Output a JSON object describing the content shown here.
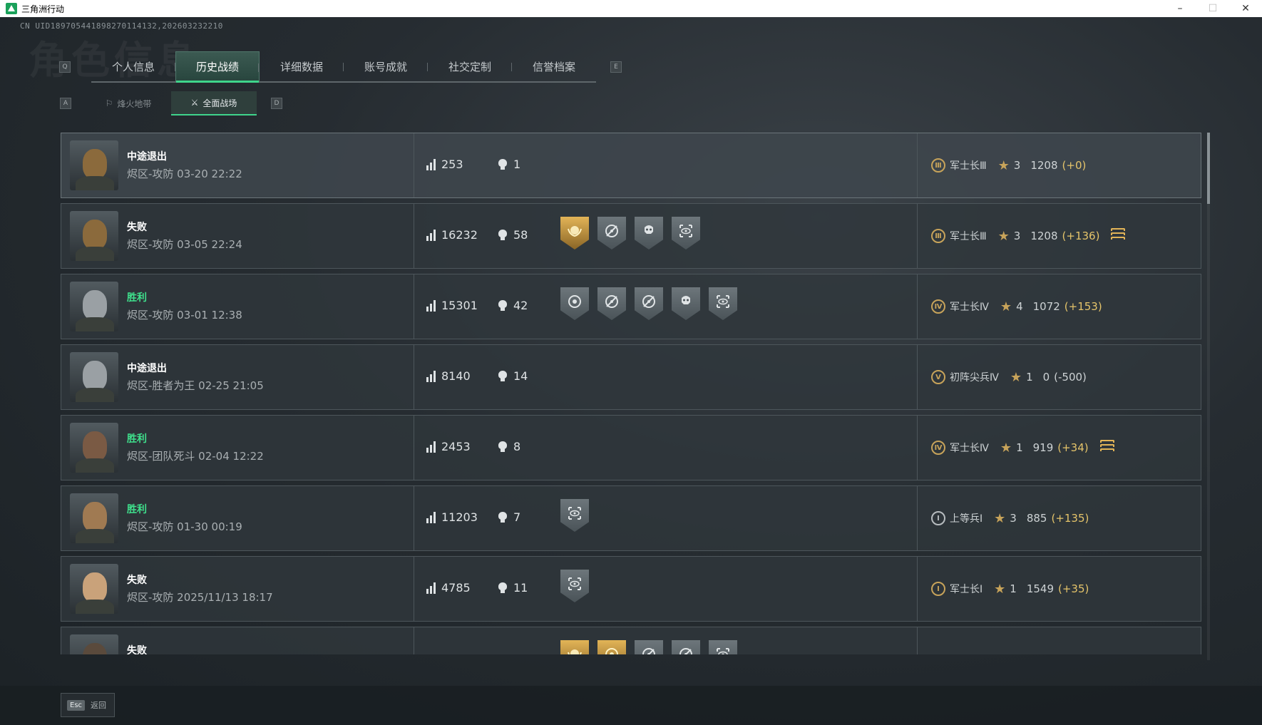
{
  "window": {
    "title": "三角洲行动",
    "minimize": "–",
    "maximize": "☐",
    "close": "✕"
  },
  "uid": "CN UID189705441898270114132,202603232210",
  "watermark": "角色信息",
  "hints": {
    "main_left": "Q",
    "main_right": "E",
    "sub_left": "A",
    "sub_right": "D"
  },
  "main_tabs": [
    {
      "label": "个人信息",
      "active": false
    },
    {
      "label": "历史战绩",
      "active": true
    },
    {
      "label": "详细数据",
      "active": false
    },
    {
      "label": "账号成就",
      "active": false
    },
    {
      "label": "社交定制",
      "active": false
    },
    {
      "label": "信誉档案",
      "active": false
    }
  ],
  "sub_tabs": [
    {
      "label": "烽火地带",
      "active": false
    },
    {
      "label": "全面战场",
      "active": true
    }
  ],
  "matches": [
    {
      "result": "中途退出",
      "result_type": "other",
      "mode": "烬区-攻防 03-20 22:22",
      "score": "253",
      "kills": "1",
      "badges": [],
      "rank_icon": "Ⅲ",
      "rank_name": "军士长Ⅲ",
      "stars": "3",
      "points": "1208",
      "delta": "(+0)",
      "delta_type": "pos",
      "chevron": false,
      "avatar_color": "#8b6a3c"
    },
    {
      "result": "失败",
      "result_type": "loss",
      "mode": "烬区-攻防 03-05 22:24",
      "score": "16232",
      "kills": "58",
      "badges": [
        "gold-laurel",
        "crosshair",
        "skull",
        "eye-target"
      ],
      "rank_icon": "Ⅲ",
      "rank_name": "军士长Ⅲ",
      "stars": "3",
      "points": "1208",
      "delta": "(+136)",
      "delta_type": "pos",
      "chevron": true,
      "avatar_color": "#8b6a3c"
    },
    {
      "result": "胜利",
      "result_type": "win",
      "mode": "烬区-攻防 03-01 12:38",
      "score": "15301",
      "kills": "42",
      "badges": [
        "target",
        "crosshair",
        "crosshair",
        "skull",
        "eye-target"
      ],
      "rank_icon": "Ⅳ",
      "rank_name": "军士长Ⅳ",
      "stars": "4",
      "points": "1072",
      "delta": "(+153)",
      "delta_type": "pos",
      "chevron": false,
      "avatar_color": "#9aa0a4"
    },
    {
      "result": "中途退出",
      "result_type": "other",
      "mode": "烬区-胜者为王 02-25 21:05",
      "score": "8140",
      "kills": "14",
      "badges": [],
      "rank_icon": "Ⅴ",
      "rank_name": "初阵尖兵Ⅳ",
      "stars": "1",
      "points": "0",
      "delta": "(-500)",
      "delta_type": "neg",
      "chevron": false,
      "avatar_color": "#9aa0a4"
    },
    {
      "result": "胜利",
      "result_type": "win",
      "mode": "烬区-团队死斗 02-04 12:22",
      "score": "2453",
      "kills": "8",
      "badges": [],
      "rank_icon": "Ⅳ",
      "rank_name": "军士长Ⅳ",
      "stars": "1",
      "points": "919",
      "delta": "(+34)",
      "delta_type": "pos",
      "chevron": true,
      "avatar_color": "#7a5a44"
    },
    {
      "result": "胜利",
      "result_type": "win",
      "mode": "烬区-攻防 01-30 00:19",
      "score": "11203",
      "kills": "7",
      "badges": [
        "eye-target"
      ],
      "rank_icon": "Ⅰ",
      "rank_name": "上等兵Ⅰ",
      "stars": "3",
      "points": "885",
      "delta": "(+135)",
      "delta_type": "pos",
      "chevron": false,
      "avatar_color": "#a07a52",
      "rank_gray": true
    },
    {
      "result": "失败",
      "result_type": "loss",
      "mode": "烬区-攻防 2025/11/13 18:17",
      "score": "4785",
      "kills": "11",
      "badges": [
        "eye-target"
      ],
      "rank_icon": "Ⅰ",
      "rank_name": "军士长Ⅰ",
      "stars": "1",
      "points": "1549",
      "delta": "(+35)",
      "delta_type": "pos",
      "chevron": false,
      "avatar_color": "#c9a27a"
    },
    {
      "result": "失败",
      "result_type": "loss",
      "mode": "",
      "score": "",
      "kills": "",
      "badges": [
        "gold-laurel",
        "gold-target",
        "crosshair",
        "crosshair",
        "eye-target"
      ],
      "rank_icon": "",
      "rank_name": "",
      "stars": "",
      "points": "",
      "delta": "",
      "delta_type": "pos",
      "chevron": true,
      "avatar_color": "#5a4a3c"
    }
  ],
  "footer": {
    "esc_key": "Esc",
    "back_label": "返回"
  }
}
